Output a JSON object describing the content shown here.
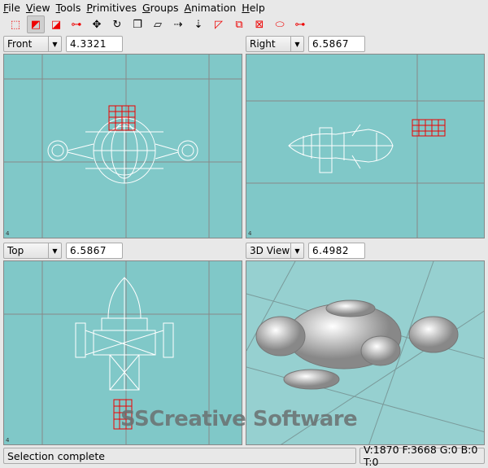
{
  "menu": [
    "File",
    "View",
    "Tools",
    "Primitives",
    "Groups",
    "Animation",
    "Help"
  ],
  "toolbar": [
    {
      "name": "select-vertices",
      "glyph": "⬚"
    },
    {
      "name": "select-faces",
      "glyph": "◩"
    },
    {
      "name": "select-groups",
      "glyph": "◪"
    },
    {
      "name": "select-bones",
      "glyph": "⊶"
    },
    {
      "name": "move",
      "glyph": "✥"
    },
    {
      "name": "rotate",
      "glyph": "↻"
    },
    {
      "name": "scale",
      "glyph": "❐"
    },
    {
      "name": "shear",
      "glyph": "▱"
    },
    {
      "name": "select-connected",
      "glyph": "⇢"
    },
    {
      "name": "add-vertex",
      "glyph": "⇣"
    },
    {
      "name": "cube",
      "glyph": "◸"
    },
    {
      "name": "box",
      "glyph": "⧉"
    },
    {
      "name": "sphere",
      "glyph": "⊠"
    },
    {
      "name": "cylinder",
      "glyph": "⬭"
    },
    {
      "name": "torus",
      "glyph": "⊶"
    }
  ],
  "viewports": [
    {
      "view": "Front",
      "zoom": "4.3321",
      "corner": "4"
    },
    {
      "view": "Right",
      "zoom": "6.5867",
      "corner": "4"
    },
    {
      "view": "Top",
      "zoom": "6.5867",
      "corner": "4"
    },
    {
      "view": "3D View",
      "zoom": "6.4982",
      "corner": ""
    }
  ],
  "watermark": "SSCreative Software",
  "status": {
    "message": "Selection complete",
    "stats": "V:1870 F:3668 G:0 B:0 T:0"
  }
}
